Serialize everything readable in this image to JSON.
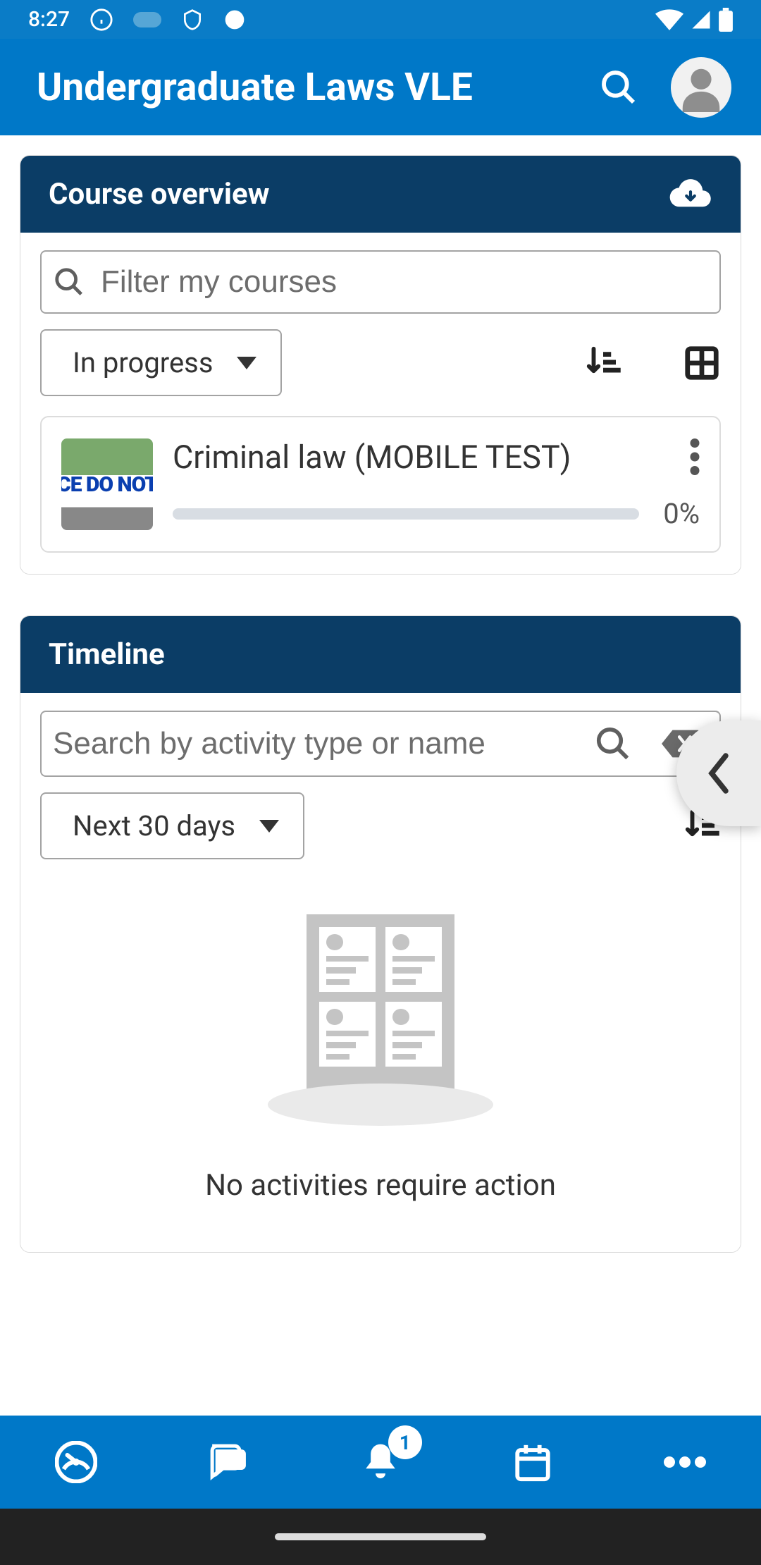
{
  "status": {
    "time": "8:27"
  },
  "header": {
    "title": "Undergraduate Laws VLE"
  },
  "course_overview": {
    "title": "Course overview",
    "filter_placeholder": "Filter my courses",
    "status_filter": "In progress",
    "courses": [
      {
        "title": "Criminal law (MOBILE TEST)",
        "progress_pct": "0%",
        "thumb_caption": "CE DO NOT"
      }
    ]
  },
  "timeline": {
    "title": "Timeline",
    "search_placeholder": "Search by activity type or name",
    "range_filter": "Next 30 days",
    "empty_message": "No activities require action"
  },
  "nav": {
    "notification_badge": "1"
  }
}
